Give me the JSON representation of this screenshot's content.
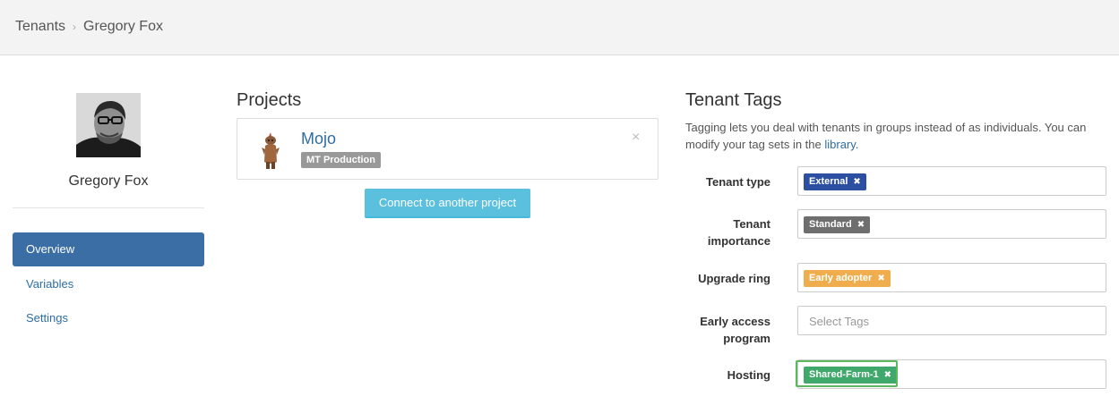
{
  "breadcrumb": {
    "root": "Tenants",
    "separator": "›",
    "current": "Gregory Fox"
  },
  "profile": {
    "name": "Gregory Fox"
  },
  "sidebar": {
    "items": [
      {
        "label": "Overview",
        "active": true
      },
      {
        "label": "Variables",
        "active": false
      },
      {
        "label": "Settings",
        "active": false
      }
    ]
  },
  "projects": {
    "title": "Projects",
    "card": {
      "name": "Mojo",
      "environment": "MT Production",
      "close_glyph": "×"
    },
    "connect_label": "Connect to another project"
  },
  "tags": {
    "title": "Tenant Tags",
    "description_before": "Tagging lets you deal with tenants in groups instead of as individuals. You can modify your tag sets in the ",
    "description_link": "library",
    "description_after": ".",
    "remove_glyph": "✖",
    "rows": [
      {
        "label": "Tenant type",
        "tag": "External",
        "color": "#2d4fa1"
      },
      {
        "label": "Tenant importance",
        "tag": "Standard",
        "color": "#6e6e6e"
      },
      {
        "label": "Upgrade ring",
        "tag": "Early adopter",
        "color": "#f0ad4e"
      },
      {
        "label": "Early access program",
        "placeholder": "Select Tags"
      },
      {
        "label": "Hosting",
        "tag": "Shared-Farm-1",
        "color": "#3fa86a"
      }
    ]
  },
  "colors": {
    "accent": "#3a6ea5",
    "link": "#2e6da4",
    "button": "#5bc0de",
    "focus": "#5cb85c"
  }
}
